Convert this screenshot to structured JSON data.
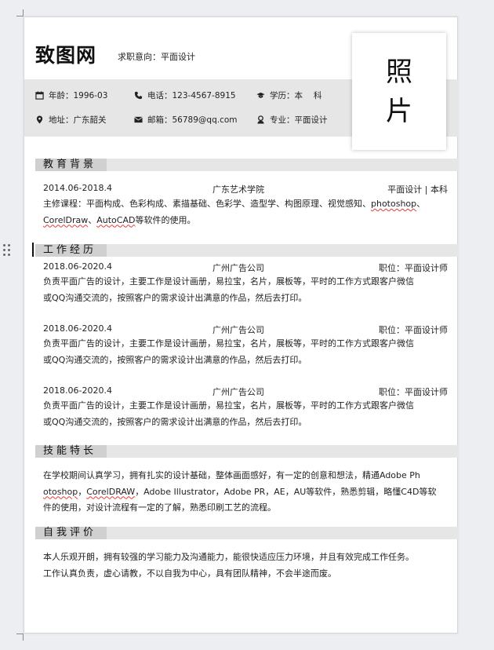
{
  "header": {
    "name": "致图网",
    "intent_label": "求职意向：",
    "intent_value": "平面设计",
    "photo_chars": [
      "照",
      "片"
    ]
  },
  "info": {
    "age": {
      "label": "年龄：",
      "value": "1996-03",
      "icon": "calendar-icon"
    },
    "phone": {
      "label": "电话：",
      "value": "123-4567-8915",
      "icon": "phone-icon"
    },
    "education": {
      "label": "学历：",
      "value": "本　 科",
      "icon": "graduation-cap-icon"
    },
    "address": {
      "label": "地址：",
      "value": "广东韶关",
      "icon": "location-pin-icon"
    },
    "email": {
      "label": "邮箱：",
      "value": "56789@qq.com",
      "icon": "envelope-icon"
    },
    "major": {
      "label": "专业：",
      "value": "平面设计",
      "icon": "user-icon"
    }
  },
  "education": {
    "title": "教育背景",
    "period": "2014.06-2018.4",
    "school": "广东艺术学院",
    "degree": "平面设计 | 本科",
    "courses_prefix": "主修课程：平面构成、色彩构成、素描基础、色彩学、造型学、构图原理、视觉感知、",
    "courses_w1": "photoshop",
    "courses_sep1": "、",
    "courses_w2": "CorelDraw",
    "courses_sep2": "、",
    "courses_w3": "AutoCAD",
    "courses_suffix": "等软件的使用。"
  },
  "work": {
    "title": "工作经历",
    "jobs": [
      {
        "period": "2018.06-2020.4",
        "company": "广州广告公司",
        "position": "职位：平面设计师",
        "desc_line1": "负责平面广告的设计，主要工作是设计画册，易拉宝，名片，展板等，平时的工作方式跟客户微信",
        "desc_line2": "或QQ沟通交流的，按照客户的需求设计出满意的作品，然后去打印。"
      },
      {
        "period": "2018.06-2020.4",
        "company": "广州广告公司",
        "position": "职位：平面设计师",
        "desc_line1": "负责平面广告的设计，主要工作是设计画册，易拉宝，名片，展板等，平时的工作方式跟客户微信",
        "desc_line2": "或QQ沟通交流的，按照客户的需求设计出满意的作品，然后去打印。"
      },
      {
        "period": "2018.06-2020.4",
        "company": "广州广告公司",
        "position": "职位：平面设计师",
        "desc_line1": "负责平面广告的设计，主要工作是设计画册，易拉宝，名片，展板等，平时的工作方式跟客户微信",
        "desc_line2": "或QQ沟通交流的，按照客户的需求设计出满意的作品，然后去打印。"
      }
    ]
  },
  "skills": {
    "title": "技能特长",
    "line1": "在学校期间认真学习，拥有扎实的设计基础，整体画面感好，有一定的创意和想法，精通Adobe Ph",
    "line2_w1": "otoshop",
    "line2_sep": "，",
    "line2_w2": "CorelDRAW",
    "line2_rest": "，Adobe Illustrator，Adobe PR，AE，AU等软件，熟悉剪辑，略懂C4D等软",
    "line3": "件的使用，对设计流程有一定的了解，熟悉印刷工艺的流程。"
  },
  "self_eval": {
    "title": "自我评价",
    "line1": "本人乐观开朗，拥有较强的学习能力及沟通能力，能很快适应压力环境，并且有效完成工作任务。",
    "line2": "工作认真负责，虚心请教，不以自我为中心，具有团队精神，不会半途而废。"
  },
  "colors": {
    "band": "#e6e6e6",
    "title_tab": "#d0d0d0",
    "spell_underline": "#e53935"
  }
}
